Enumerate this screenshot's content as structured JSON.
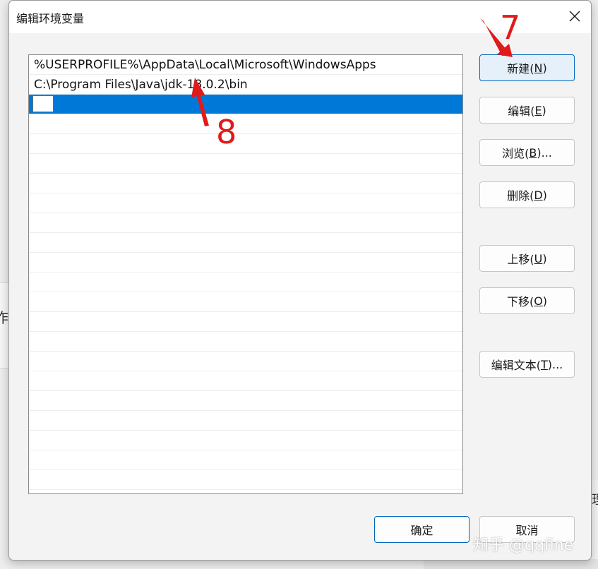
{
  "dialog": {
    "title": "编辑环境变量"
  },
  "list": {
    "items": [
      "%USERPROFILE%\\AppData\\Local\\Microsoft\\WindowsApps",
      "C:\\Program Files\\Java\\jdk-18.0.2\\bin",
      ""
    ]
  },
  "buttons": {
    "new": {
      "text": "新建(",
      "key": "N",
      "end": ")"
    },
    "edit": {
      "text": "编辑(",
      "key": "E",
      "end": ")"
    },
    "browse": {
      "text": "浏览(",
      "key": "B",
      "end": ")..."
    },
    "delete": {
      "text": "删除(",
      "key": "D",
      "end": ")"
    },
    "move_up": {
      "text": "上移(",
      "key": "U",
      "end": ")"
    },
    "move_down": {
      "text": "下移(",
      "key": "O",
      "end": ")"
    },
    "edit_text": {
      "text": "编辑文本(",
      "key": "T",
      "end": ")..."
    },
    "ok": "确定",
    "cancel": "取消"
  },
  "annotations": {
    "step7": "7",
    "step8": "8"
  },
  "watermark": "知乎 @qqfine",
  "background": {
    "left_glyph": "作",
    "right_glyph": "理"
  },
  "colors": {
    "selection": "#0078d7",
    "annotation": "#e01a1a",
    "primary_border": "#0067c0"
  }
}
